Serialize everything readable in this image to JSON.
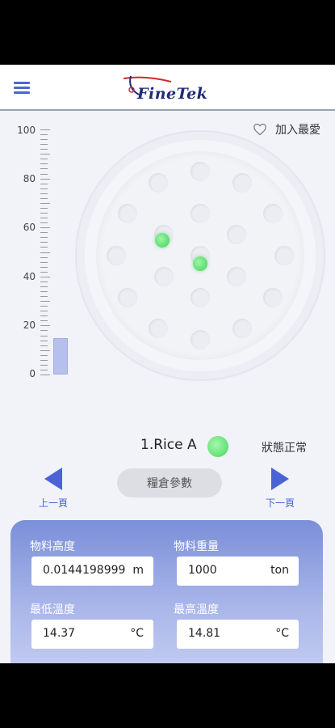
{
  "header": {
    "logo_text": "FineTek",
    "menu_icon": "hamburger-icon"
  },
  "favorite": {
    "label": "加入最愛",
    "icon": "heart-icon"
  },
  "scale": {
    "ticks": [
      "100",
      "80",
      "60",
      "40",
      "20",
      "0"
    ],
    "level_percent": 15
  },
  "silo": {
    "name": "1.Rice A",
    "status": "狀態正常",
    "status_color": "#46d864"
  },
  "nav": {
    "prev_label": "上一頁",
    "next_label": "下一頁",
    "param_button": "糧倉參數",
    "accent": "#4a63d6"
  },
  "fields": {
    "material_height": {
      "label": "物料高度",
      "value": "0.0144198999",
      "unit": "m"
    },
    "material_weight": {
      "label": "物料重量",
      "value": "1000",
      "unit": "ton"
    },
    "min_temp": {
      "label": "最低溫度",
      "value": "14.37",
      "unit": "°C"
    },
    "max_temp": {
      "label": "最高溫度",
      "value": "14.81",
      "unit": "°C"
    }
  }
}
